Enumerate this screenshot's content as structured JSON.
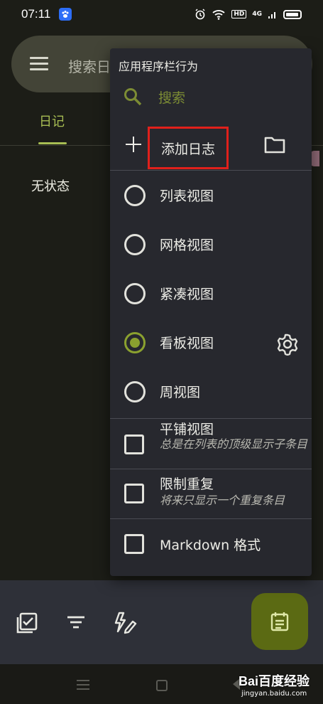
{
  "status_bar": {
    "time": "07:11",
    "hd": "HD",
    "signal": "4G"
  },
  "header": {
    "search_placeholder": "搜索日"
  },
  "tabs": [
    {
      "label": "日记"
    }
  ],
  "content": {
    "status_text": "无状态"
  },
  "menu": {
    "title": "应用程序栏行为",
    "search_label": "搜索",
    "add_journal_label": "添加日志",
    "views": [
      {
        "label": "列表视图",
        "selected": false
      },
      {
        "label": "网格视图",
        "selected": false
      },
      {
        "label": "紧凑视图",
        "selected": false
      },
      {
        "label": "看板视图",
        "selected": true
      },
      {
        "label": "周视图",
        "selected": false
      }
    ],
    "options": [
      {
        "label": "平铺视图",
        "sub": "总是在列表的顶级显示子条目",
        "checked": false
      },
      {
        "label": "限制重复",
        "sub": "将来只显示一个重复条目",
        "checked": false
      },
      {
        "label": "Markdown 格式",
        "sub": "",
        "checked": false
      }
    ]
  },
  "colors": {
    "accent": "#8ba12f",
    "fab": "#5b6a13",
    "highlight_box": "#e0201b"
  },
  "watermark": {
    "logo": "Bai百度经验",
    "url": "jingyan.baidu.com"
  }
}
